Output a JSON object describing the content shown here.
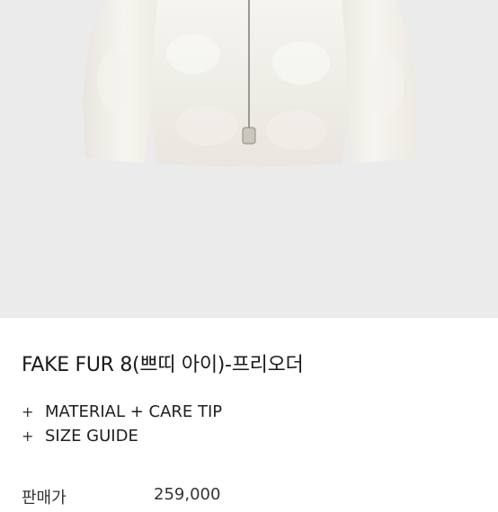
{
  "product": {
    "image_alt": "white fake fur zip jacket",
    "title": "FAKE FUR 8(쁘띠 아이)-프리오더"
  },
  "info_links": [
    {
      "icon": "plus-icon",
      "plus": "+",
      "label": "MATERIAL + CARE TIP"
    },
    {
      "icon": "plus-icon",
      "plus": "+",
      "label": "SIZE GUIDE"
    }
  ],
  "price": {
    "label": "판매가",
    "value": "259,000"
  },
  "colors": {
    "hero_bg": "#ebebeb",
    "jacket": "#f5f3ee",
    "text": "#1a1a1a"
  }
}
